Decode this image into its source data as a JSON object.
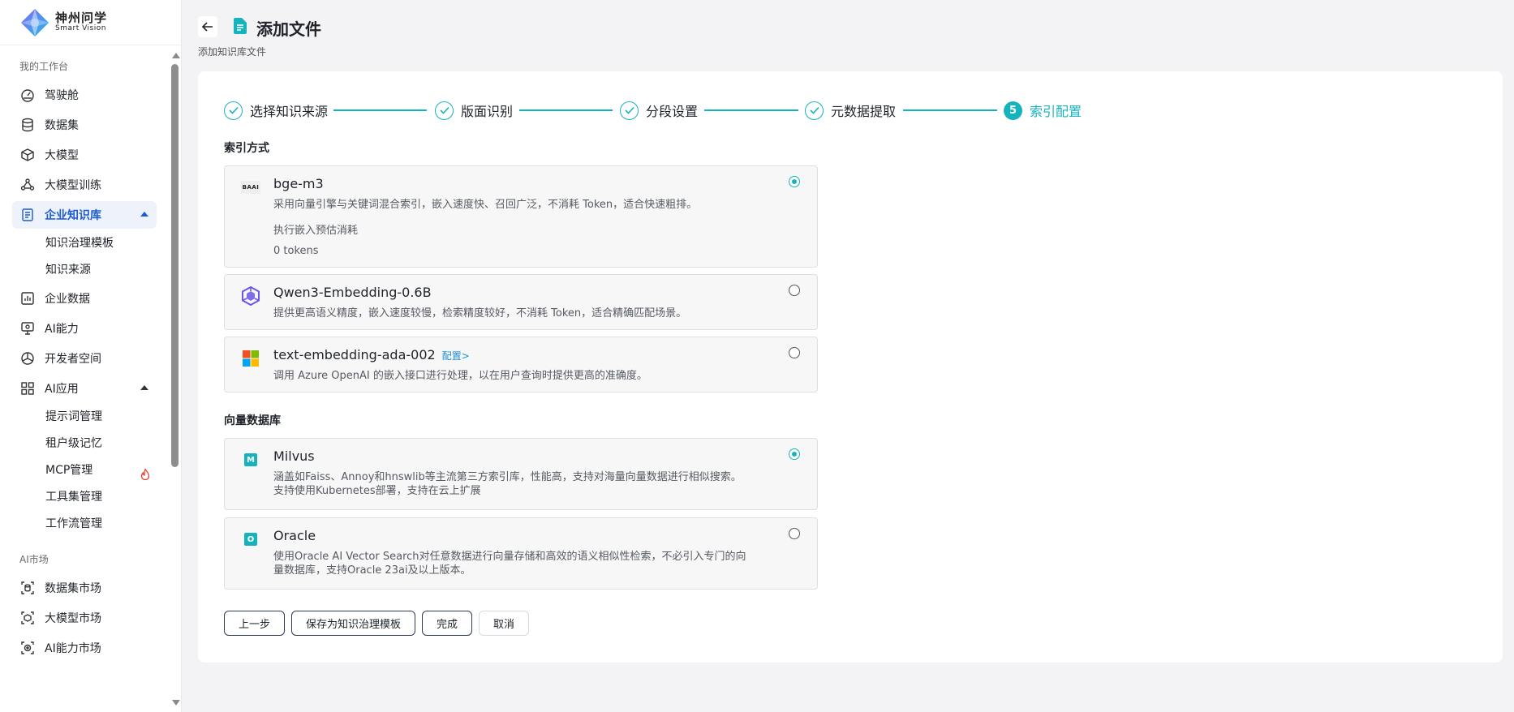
{
  "brand": {
    "name": "神州问学",
    "sub": "Smart Vision"
  },
  "sidebar": {
    "section_workspace": "我的工作台",
    "items": [
      {
        "label": "驾驶舱",
        "icon": "dashboard-icon"
      },
      {
        "label": "数据集",
        "icon": "database-icon"
      },
      {
        "label": "大模型",
        "icon": "cube-icon"
      },
      {
        "label": "大模型训练",
        "icon": "training-icon"
      },
      {
        "label": "企业知识库",
        "icon": "knowledge-icon",
        "active": true
      },
      {
        "label": "企业数据",
        "icon": "bar-chart-icon"
      },
      {
        "label": "AI能力",
        "icon": "monitor-icon"
      },
      {
        "label": "开发者空间",
        "icon": "developer-icon"
      },
      {
        "label": "AI应用",
        "icon": "apps-grid-icon"
      }
    ],
    "knowledge_sub": [
      "知识治理模板",
      "知识来源"
    ],
    "ai_app_sub": [
      "提示词管理",
      "租户级记忆",
      "MCP管理",
      "工具集管理",
      "工作流管理"
    ],
    "section_market": "AI市场",
    "market_items": [
      {
        "label": "数据集市场",
        "icon": "dataset-market-icon"
      },
      {
        "label": "大模型市场",
        "icon": "model-market-icon"
      },
      {
        "label": "AI能力市场",
        "icon": "ai-market-icon"
      }
    ]
  },
  "header": {
    "title": "添加文件",
    "subtitle": "添加知识库文件"
  },
  "steps": [
    {
      "label": "选择知识来源",
      "done": true
    },
    {
      "label": "版面识别",
      "done": true
    },
    {
      "label": "分段设置",
      "done": true
    },
    {
      "label": "元数据提取",
      "done": true
    },
    {
      "label": "索引配置",
      "number": "5",
      "current": true
    }
  ],
  "index_section": {
    "title": "索引方式",
    "options": [
      {
        "name": "bge-m3",
        "icon_text": "BAAI",
        "desc": "采用向量引擎与关键词混合索引，嵌入速度快、召回广泛，不消耗 Token，适合快速粗排。",
        "extra_label": "执行嵌入预估消耗",
        "extra_value": "0 tokens",
        "selected": true
      },
      {
        "name": "Qwen3-Embedding-0.6B",
        "desc": "提供更高语义精度，嵌入速度较慢，检索精度较好，不消耗 Token，适合精确匹配场景。",
        "selected": false
      },
      {
        "name": "text-embedding-ada-002",
        "link": "配置>",
        "desc": "调用 Azure OpenAI 的嵌入接口进行处理，以在用户查询时提供更高的准确度。",
        "selected": false
      }
    ]
  },
  "vector_section": {
    "title": "向量数据库",
    "options": [
      {
        "name": "Milvus",
        "icon_letter": "M",
        "desc_line1": "涵盖如Faiss、Annoy和hnswlib等主流第三方索引库，性能高，支持对海量向量数据进行相似搜索。",
        "desc_line2": "支持使用Kubernetes部署，支持在云上扩展",
        "selected": true
      },
      {
        "name": "Oracle",
        "icon_letter": "O",
        "desc_line1": "使用Oracle AI Vector Search对任意数据进行向量存储和高效的语义相似性检索，不必引入专门的向",
        "desc_line2": "量数据库，支持Oracle 23ai及以上版本。",
        "selected": false
      }
    ]
  },
  "buttons": {
    "prev": "上一步",
    "save_template": "保存为知识治理模板",
    "finish": "完成",
    "cancel": "取消"
  },
  "colors": {
    "accent": "#17b3bd",
    "active_nav": "#1b5bd6"
  }
}
